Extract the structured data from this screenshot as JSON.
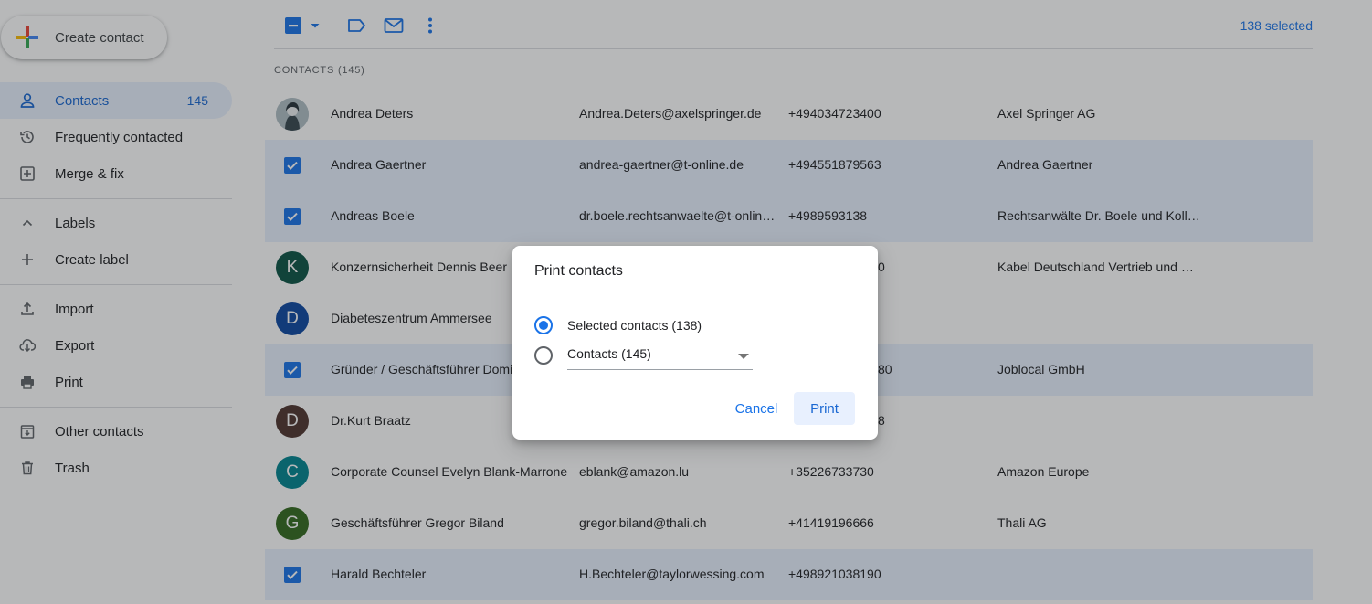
{
  "sidebar": {
    "create_label": "Create contact",
    "items": [
      {
        "label": "Contacts",
        "count": "145",
        "icon": "person-icon"
      },
      {
        "label": "Frequently contacted",
        "icon": "history-icon"
      },
      {
        "label": "Merge & fix",
        "icon": "merge-fix-icon"
      },
      {
        "label": "Labels",
        "icon": "chevron-up-icon"
      },
      {
        "label": "Create label",
        "icon": "plus-icon"
      },
      {
        "label": "Import",
        "icon": "upload-icon"
      },
      {
        "label": "Export",
        "icon": "cloud-download-icon"
      },
      {
        "label": "Print",
        "icon": "printer-icon"
      },
      {
        "label": "Other contacts",
        "icon": "archive-person-icon"
      },
      {
        "label": "Trash",
        "icon": "trash-icon"
      }
    ]
  },
  "toolbar": {
    "selected_text": "138 selected"
  },
  "main": {
    "section_label": "CONTACTS (145)",
    "rows": [
      {
        "name": "Andrea Deters",
        "email": "Andrea.Deters@axelspringer.de",
        "phone": "+494034723400",
        "company": "Axel Springer AG",
        "selected": false,
        "avatar": "photo"
      },
      {
        "name": "Andrea Gaertner",
        "email": "andrea-gaertner@t-online.de",
        "phone": "+494551879563",
        "company": "Andrea Gaertner",
        "selected": true
      },
      {
        "name": "Andreas Boele",
        "email": "dr.boele.rechtsanwaelte@t-online.de",
        "phone": "+4989593138",
        "company": "Rechtsanwälte Dr. Boele und Kollegen",
        "selected": true
      },
      {
        "name": "Konzernsicherheit Dennis Beer",
        "email": "",
        "phone": "0",
        "company": "Kabel Deutschland Vertrieb und Service",
        "selected": false,
        "initial": "K",
        "color": "#0b5345"
      },
      {
        "name": "Diabeteszentrum Ammersee",
        "email": "",
        "phone": "",
        "company": "",
        "selected": false,
        "initial": "D",
        "color": "#0d47a1"
      },
      {
        "name": "Gründer / Geschäftsführer Dominik",
        "email": "",
        "phone": "80",
        "company": "Joblocal GmbH",
        "selected": true
      },
      {
        "name": "Dr.Kurt Braatz",
        "email": "",
        "phone": "8",
        "company": "",
        "selected": false,
        "initial": "D",
        "color": "#4e342e"
      },
      {
        "name": "Corporate Counsel Evelyn Blank-Marrone",
        "email": "eblank@amazon.lu",
        "phone": "+35226733730",
        "company": "Amazon Europe",
        "selected": false,
        "initial": "C",
        "color": "#00838f"
      },
      {
        "name": "Geschäftsführer Gregor Biland",
        "email": "gregor.biland@thali.ch",
        "phone": "+41419196666",
        "company": "Thali AG",
        "selected": false,
        "initial": "G",
        "color": "#33691e"
      },
      {
        "name": "Harald Bechteler",
        "email": "H.Bechteler@taylorwessing.com",
        "phone": "+498921038190",
        "company": "",
        "selected": true
      }
    ]
  },
  "dialog": {
    "title": "Print contacts",
    "option_selected": "Selected contacts (138)",
    "option_all": "Contacts (145)",
    "cancel_label": "Cancel",
    "print_label": "Print"
  },
  "colors": {
    "accent": "#1a73e8",
    "selected_row": "#e8f0fe"
  }
}
